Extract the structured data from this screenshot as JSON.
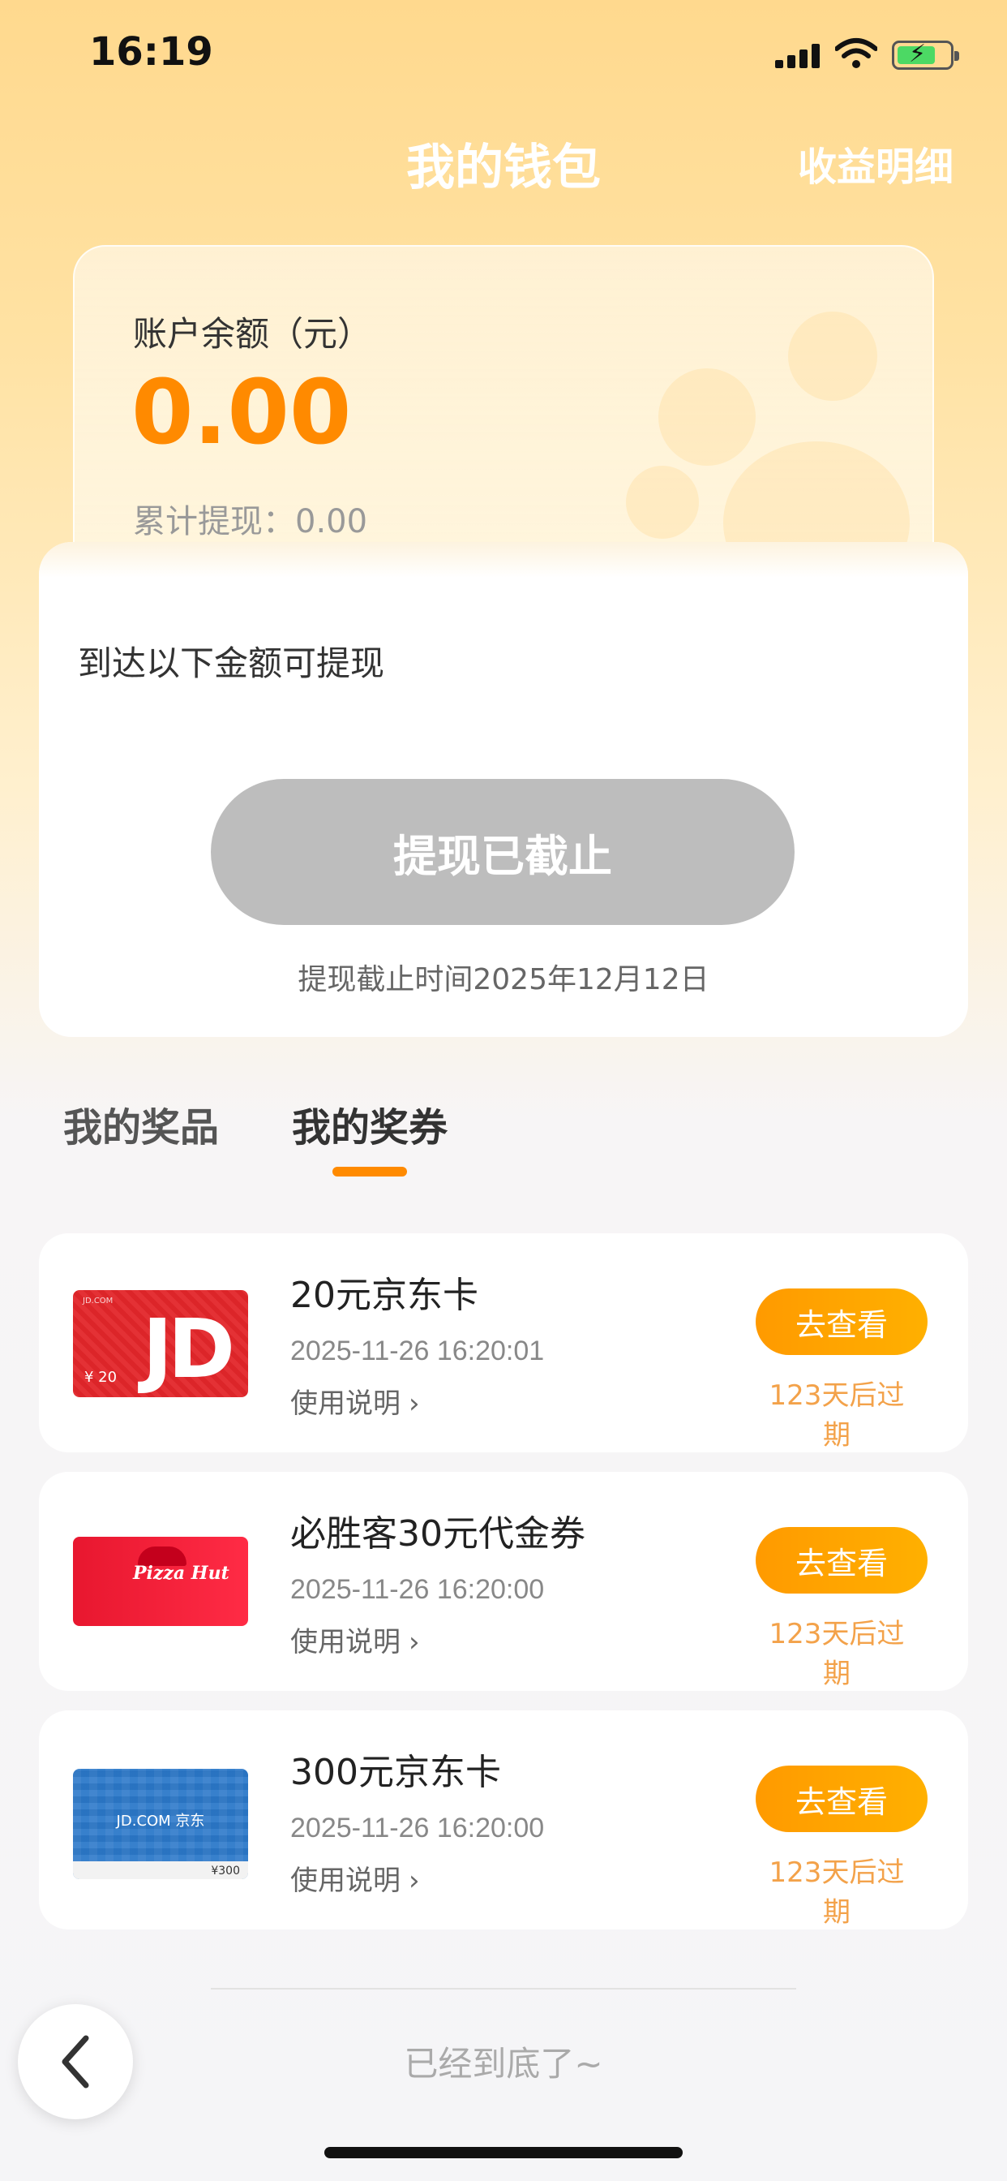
{
  "status_bar": {
    "time": "16:19",
    "icons": [
      "signal-icon",
      "wifi-icon",
      "battery-charging-icon"
    ]
  },
  "header": {
    "title": "我的钱包",
    "right_link": "收益明细"
  },
  "balance": {
    "label": "账户余额（元）",
    "amount": "0.00",
    "withdrawn_label": "累计提现：",
    "withdrawn_value": "0.00"
  },
  "withdraw": {
    "hint": "到达以下金额可提现",
    "button_label": "提现已截止",
    "deadline": "提现截止时间2025年12月12日"
  },
  "tabs": [
    {
      "label": "我的奖品",
      "active": false
    },
    {
      "label": "我的奖券",
      "active": true
    }
  ],
  "coupons": [
    {
      "title": "20元京东卡",
      "date": "2025-11-26 16:20:01",
      "usage": "使用说明",
      "button": "去查看",
      "expiry": "123天后过期",
      "thumb": {
        "logo": "JD",
        "price": "¥ 20"
      }
    },
    {
      "title": "必胜客30元代金券",
      "date": "2025-11-26 16:20:00",
      "usage": "使用说明",
      "button": "去查看",
      "expiry": "123天后过期",
      "thumb": {
        "logo": "Pizza Hut"
      }
    },
    {
      "title": "300元京东卡",
      "date": "2025-11-26 16:20:00",
      "usage": "使用说明",
      "button": "去查看",
      "expiry": "123天后过期",
      "thumb": {
        "logo": "JD.COM 京东",
        "price": "¥300"
      }
    }
  ],
  "footer": {
    "end_text": "已经到底了~"
  },
  "colors": {
    "accent": "#ff8a00",
    "button_disabled": "#bdbdbd",
    "expiry": "#f3a24a"
  }
}
